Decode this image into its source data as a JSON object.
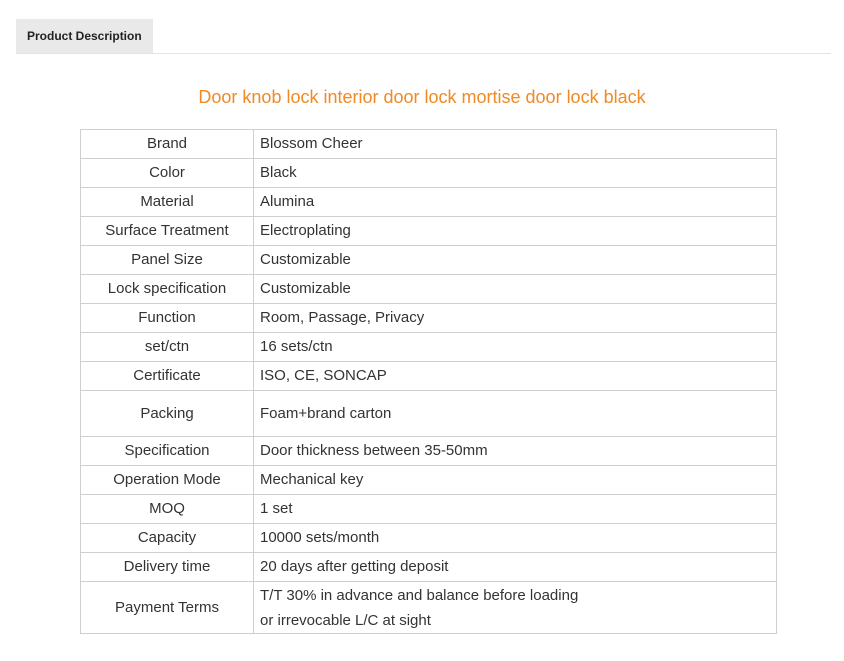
{
  "tab": {
    "label": "Product Description"
  },
  "title": "Door knob lock interior door lock mortise door lock black",
  "specs": [
    {
      "key": "Brand",
      "value": "Blossom Cheer"
    },
    {
      "key": "Color",
      "value": "Black"
    },
    {
      "key": "Material",
      "value": "Alumina"
    },
    {
      "key": "Surface Treatment",
      "value": "Electroplating"
    },
    {
      "key": "Panel Size",
      "value": "Customizable"
    },
    {
      "key": "Lock specification",
      "value": "Customizable"
    },
    {
      "key": "Function",
      "value": "Room, Passage, Privacy"
    },
    {
      "key": "set/ctn",
      "value": "16 sets/ctn"
    },
    {
      "key": "Certificate",
      "value": "ISO, CE, SONCAP"
    },
    {
      "key": "Packing",
      "value": "Foam+brand carton"
    },
    {
      "key": "Specification",
      "value": "Door thickness between 35-50mm"
    },
    {
      "key": "Operation Mode",
      "value": "Mechanical key"
    },
    {
      "key": "MOQ",
      "value": "1 set"
    },
    {
      "key": "Capacity",
      "value": "10000 sets/month"
    },
    {
      "key": "Delivery time",
      "value": "20 days after getting deposit"
    },
    {
      "key": "Payment Terms",
      "value_line1": "T/T 30% in advance and balance before loading",
      "value_line2": "or irrevocable L/C at sight"
    }
  ],
  "colors": {
    "title": "#f08a24",
    "tab_bg": "#e9e9e9",
    "border": "#cfcfcf"
  }
}
